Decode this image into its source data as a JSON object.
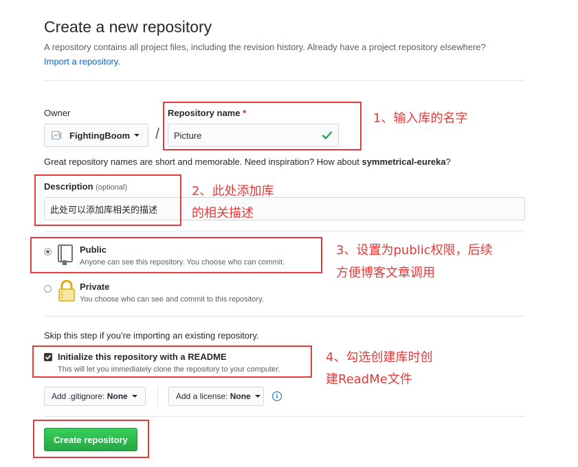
{
  "header": {
    "title": "Create a new repository",
    "subtitle": "A repository contains all project files, including the revision history. Already have a project repository elsewhere?",
    "import_link": "Import a repository."
  },
  "owner": {
    "label": "Owner",
    "avatar_alt": "(",
    "value": "FightingBoom"
  },
  "repo_name": {
    "label": "Repository name",
    "required_mark": "*",
    "value": "Picture",
    "status_icon": "check-icon"
  },
  "name_hint": {
    "text": "Great repository names are short and memorable. Need inspiration? How about ",
    "suggestion": "symmetrical-eureka",
    "suffix": "?"
  },
  "description": {
    "label": "Description",
    "optional": "(optional)",
    "value": "此处可以添加库相关的描述"
  },
  "visibility": {
    "public": {
      "title": "Public",
      "desc": "Anyone can see this repository. You choose who can commit.",
      "selected": true,
      "icon": "repo-book-icon"
    },
    "private": {
      "title": "Private",
      "desc": "You choose who can see and commit to this repository.",
      "selected": false,
      "icon": "lock-icon"
    }
  },
  "init": {
    "skip_text": "Skip this step if you’re importing an existing repository.",
    "readme_label": "Initialize this repository with a README",
    "readme_desc": "This will let you immediately clone the repository to your computer.",
    "checked": true
  },
  "dropdowns": {
    "gitignore_prefix": "Add .gitignore: ",
    "gitignore_value": "None",
    "license_prefix": "Add a license: ",
    "license_value": "None"
  },
  "create_button": "Create repository",
  "annotations": {
    "a1": "1、输入库的名字",
    "a2_line1": "2、此处添加库",
    "a2_line2": "的相关描述",
    "a3_line1": "3、设置为public权限，后续",
    "a3_line2": "方便博客文章调用",
    "a4_line1": "4、勾选创建库时创",
    "a4_line2": "建ReadMe文件"
  },
  "colors": {
    "annotation_red": "#e33a3a",
    "success_green": "#28a745",
    "link_blue": "#0366d6"
  }
}
